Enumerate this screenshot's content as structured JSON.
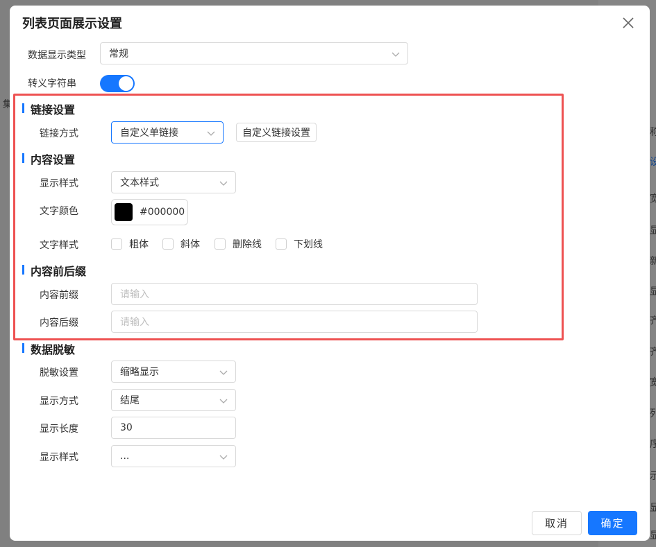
{
  "dialog": {
    "title": "列表页面展示设置",
    "cancel_label": "取消",
    "ok_label": "确定"
  },
  "general": {
    "display_type_label": "数据显示类型",
    "display_type_value": "常规",
    "escape_label": "转义字符串",
    "escape_enabled": true
  },
  "link": {
    "section_title": "链接设置",
    "method_label": "链接方式",
    "method_value": "自定义单链接",
    "custom_button": "自定义链接设置"
  },
  "content": {
    "section_title": "内容设置",
    "style_label": "显示样式",
    "style_value": "文本样式",
    "color_label": "文字颜色",
    "color_value": "#000000",
    "text_style_label": "文字样式",
    "checkboxes": [
      "粗体",
      "斜体",
      "删除线",
      "下划线"
    ]
  },
  "affix": {
    "section_title": "内容前后缀",
    "prefix_label": "内容前缀",
    "prefix_placeholder": "请输入",
    "suffix_label": "内容后缀",
    "suffix_placeholder": "请输入"
  },
  "mask": {
    "section_title": "数据脱敏",
    "setting_label": "脱敏设置",
    "setting_value": "缩略显示",
    "method_label": "显示方式",
    "method_value": "结尾",
    "length_label": "显示长度",
    "length_value": "30",
    "style_label": "显示样式",
    "style_value": "..."
  },
  "background": {
    "fragments": [
      "集",
      "称",
      "设",
      "宽",
      "显",
      "新",
      "显",
      "齐",
      "齐",
      "宽",
      "列",
      "序",
      "示",
      "显",
      "显"
    ]
  },
  "colors": {
    "accent": "#1677ff",
    "highlight_box": "#ee5252"
  }
}
